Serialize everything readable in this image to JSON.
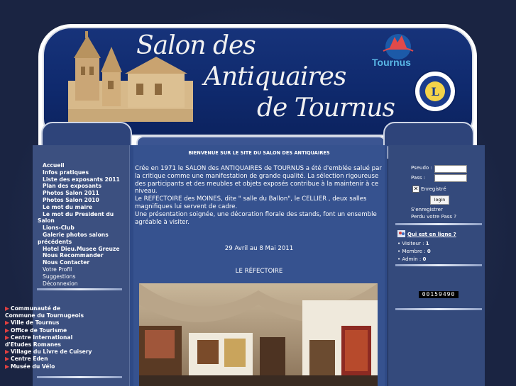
{
  "header": {
    "title_line1": "Salon des",
    "title_line2": "Antiquaires",
    "title_line3": "de Tournus",
    "tournus_logo_text": "Tournus"
  },
  "menu": [
    {
      "label": "Accueil",
      "bold": true
    },
    {
      "label": "Infos pratiques",
      "bold": true
    },
    {
      "label": "Liste des exposants 2011",
      "bold": true
    },
    {
      "label": "Plan des exposants",
      "bold": true
    },
    {
      "label": "Photos Salon 2011",
      "bold": true
    },
    {
      "label": "Photos Salon 2010",
      "bold": true
    },
    {
      "label": "Le mot du maire",
      "bold": true
    },
    {
      "label": "Le mot du President du Salon",
      "bold": true
    },
    {
      "label": "Lions-Club",
      "bold": true
    },
    {
      "label": "Galerie photos salons précédents",
      "bold": true
    },
    {
      "label": "Hotel Dieu.Musee Greuze",
      "bold": true
    },
    {
      "label": "Nous Recommander",
      "bold": true
    },
    {
      "label": "Nous Contacter",
      "bold": true
    },
    {
      "label": "Votre Profil",
      "bold": false
    },
    {
      "label": "Suggestions",
      "bold": false
    },
    {
      "label": "Déconnexion",
      "bold": false
    }
  ],
  "links": [
    "Communauté de Commune du Tournugeois",
    "Ville de Tournus",
    "Office de Tourisme",
    "Centre International d'Etudes Romanes",
    "Village du Livre de Cuisery",
    "Centre Eden",
    "Musée du Vélo"
  ],
  "content": {
    "welcome": "BIENVENUE SUR LE SITE DU SALON DES ANTIQUAIRES",
    "intro": [
      "Crée en 1971 le SALON des ANTIQUAIRES de TOURNUS a été d'emblée salué par la critique comme une manifestation de grande qualité. La sélection rigoureuse des participants et des meubles et objets exposés contribue à la maintenir à ce niveau.",
      "Le REFECTOIRE des MOINES, dite \" salle du Ballon\", le CELLIER , deux salles magnifiques lui servent de cadre.",
      "Une présentation soignée, une décoration florale des stands, font un ensemble agréable à visiter."
    ],
    "dates": "29 Avril au 8 Mai 2011",
    "photo_caption": "LE RÉFECTOIRE"
  },
  "login": {
    "pseudo_label": "Pseudo :",
    "pass_label": "Pass :",
    "remember_label": "Enregistré",
    "button": "login",
    "register": "S'enregistrer",
    "lost_pass": "Perdu votre Pass ?"
  },
  "online": {
    "title": "Qui est en ligne ?",
    "visitors_label": "Visiteur :",
    "visitors": "1",
    "members_label": "Membre :",
    "members": "0",
    "admins_label": "Admin :",
    "admins": "0"
  },
  "counter": "00159490",
  "colors": {
    "banner": "#12307a",
    "column": "#3c5080",
    "accent_arrow": "#e24040"
  }
}
